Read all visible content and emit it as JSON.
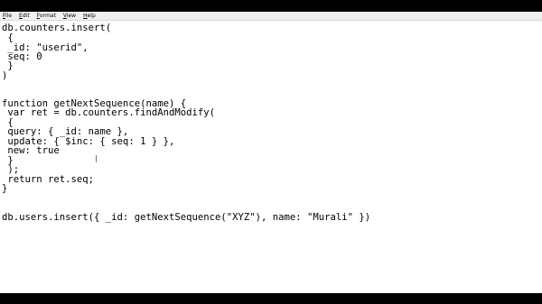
{
  "menu": {
    "items": [
      {
        "first": "F",
        "rest": "ile"
      },
      {
        "first": "E",
        "rest": "dit"
      },
      {
        "first": "F",
        "rest": "ormat"
      },
      {
        "first": "V",
        "rest": "iew"
      },
      {
        "first": "H",
        "rest": "elp"
      }
    ]
  },
  "editor": {
    "lines": [
      "db.counters.insert(",
      " {",
      " _id: \"userid\",",
      " seq: 0",
      " }",
      ")",
      "",
      "",
      "function getNextSequence(name) {",
      " var ret = db.counters.findAndModify(",
      " {",
      " query: { _id: name },",
      " update: { $inc: { seq: 1 } },",
      " new: true",
      " }",
      " );",
      " return ret.seq;",
      "}",
      "",
      "",
      "",
      "db.users.insert({ _id: getNextSequence(\"XYZ\"), name: \"Murali\" })"
    ]
  }
}
